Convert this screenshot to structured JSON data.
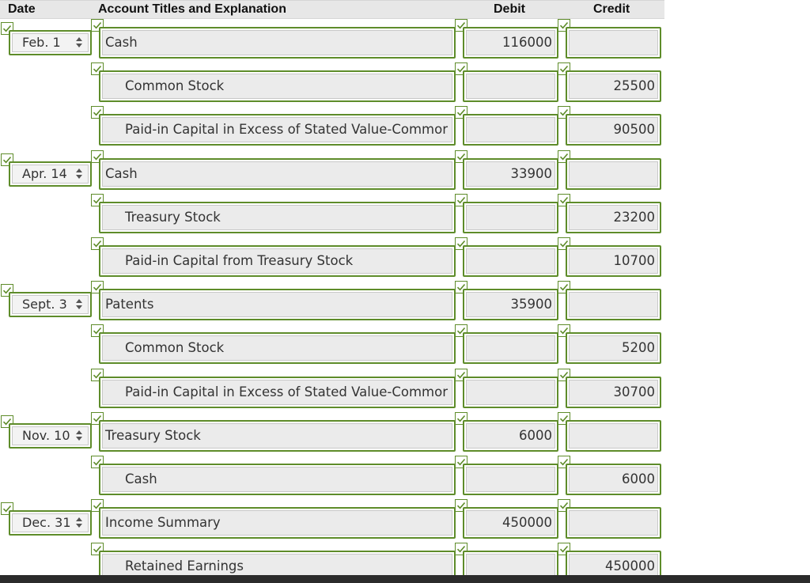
{
  "headers": {
    "date": "Date",
    "account": "Account Titles and Explanation",
    "debit": "Debit",
    "credit": "Credit"
  },
  "colors": {
    "accent_green": "#5e8c2a",
    "field_bg": "#ebebeb",
    "header_bg": "#e7e7e7"
  },
  "icons": {
    "check": "checkmark-icon",
    "spinner": "spinner-arrows-icon"
  },
  "rows": [
    {
      "date": "Feb. 1",
      "account": "Cash",
      "indent": false,
      "debit": "116000",
      "credit": ""
    },
    {
      "date": "",
      "account": "Common Stock",
      "indent": true,
      "debit": "",
      "credit": "25500"
    },
    {
      "date": "",
      "account": "Paid-in Capital in Excess of Stated Value-Commor",
      "indent": true,
      "debit": "",
      "credit": "90500"
    },
    {
      "date": "Apr. 14",
      "account": "Cash",
      "indent": false,
      "debit": "33900",
      "credit": ""
    },
    {
      "date": "",
      "account": "Treasury Stock",
      "indent": true,
      "debit": "",
      "credit": "23200"
    },
    {
      "date": "",
      "account": "Paid-in Capital from Treasury Stock",
      "indent": true,
      "debit": "",
      "credit": "10700"
    },
    {
      "date": "Sept. 3",
      "account": "Patents",
      "indent": false,
      "debit": "35900",
      "credit": ""
    },
    {
      "date": "",
      "account": "Common Stock",
      "indent": true,
      "debit": "",
      "credit": "5200"
    },
    {
      "date": "",
      "account": "Paid-in Capital in Excess of Stated Value-Commor",
      "indent": true,
      "debit": "",
      "credit": "30700"
    },
    {
      "date": "Nov. 10",
      "account": "Treasury Stock",
      "indent": false,
      "debit": "6000",
      "credit": ""
    },
    {
      "date": "",
      "account": "Cash",
      "indent": true,
      "debit": "",
      "credit": "6000"
    },
    {
      "date": "Dec. 31",
      "account": "Income Summary",
      "indent": false,
      "debit": "450000",
      "credit": ""
    },
    {
      "date": "",
      "account": "Retained Earnings",
      "indent": true,
      "debit": "",
      "credit": "450000"
    }
  ]
}
